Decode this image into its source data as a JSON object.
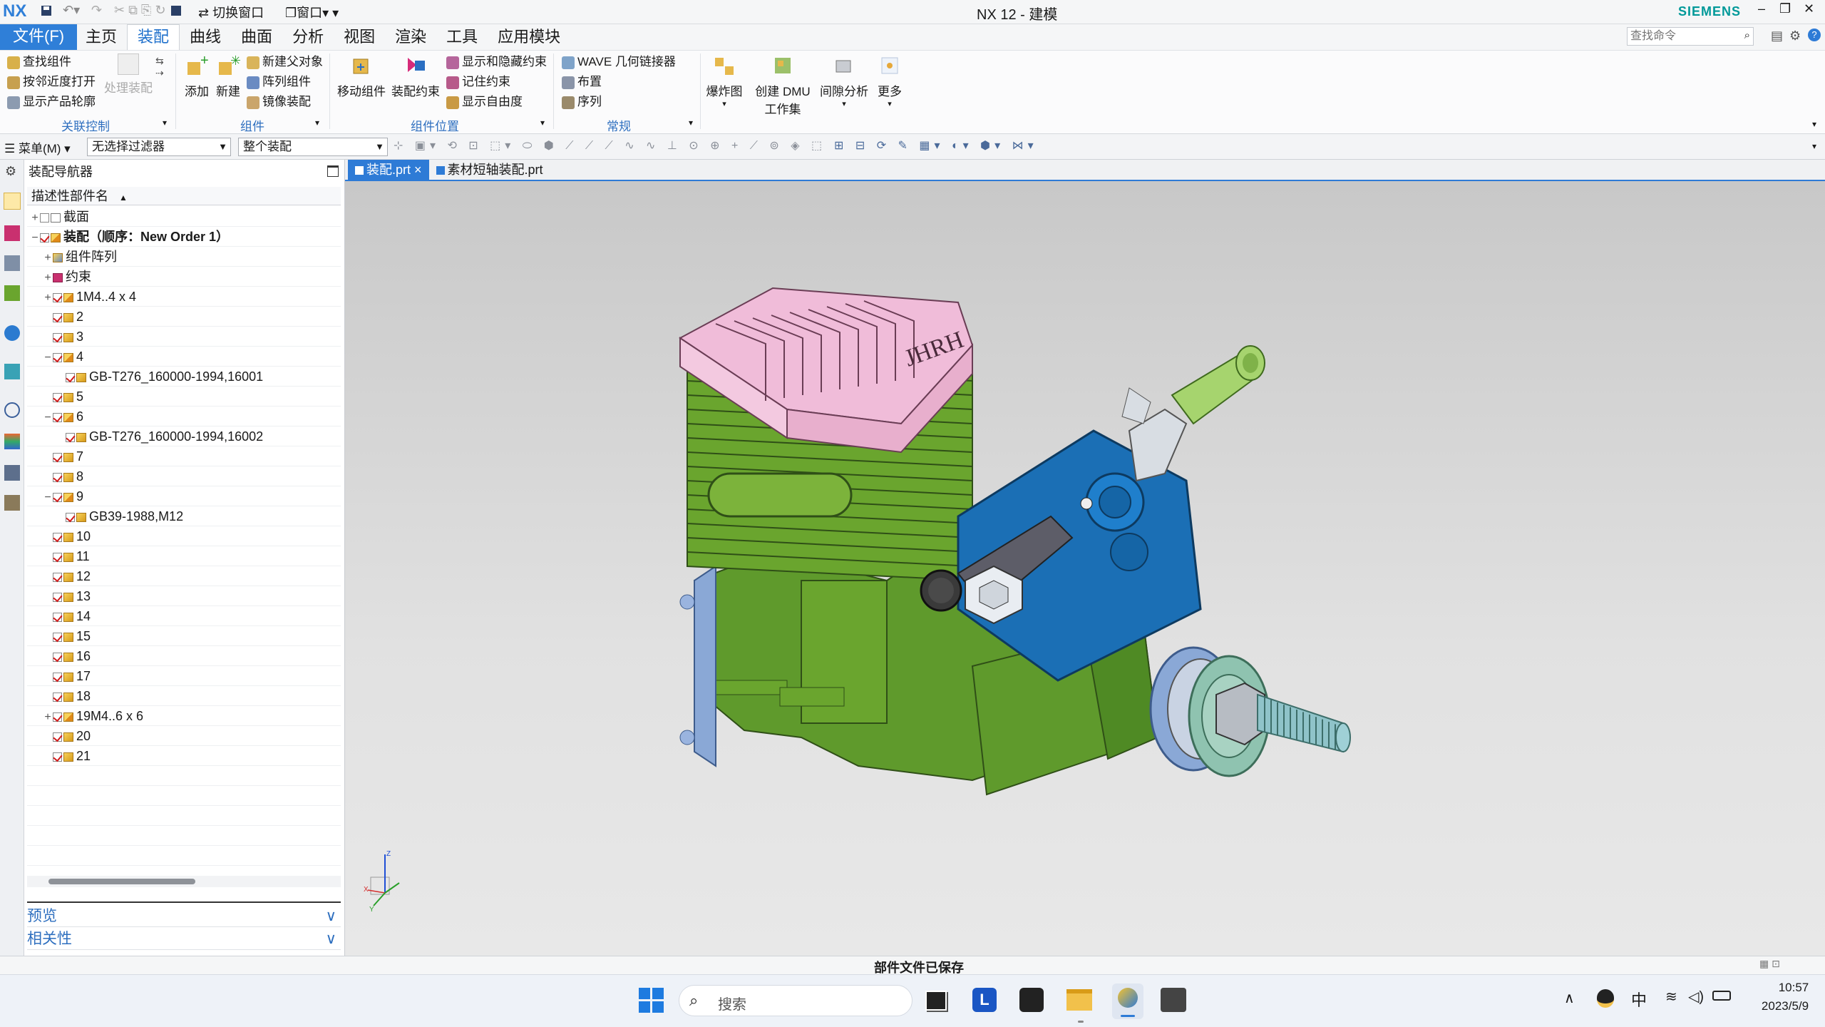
{
  "app": {
    "logo": "NX",
    "title": "NX 12 - 建模",
    "brand": "SIEMENS"
  },
  "quick": {
    "switch_window": "切换窗口",
    "window": "窗口"
  },
  "menu": {
    "file": "文件(F)",
    "items": [
      "主页",
      "装配",
      "曲线",
      "曲面",
      "分析",
      "视图",
      "渲染",
      "工具",
      "应用模块"
    ],
    "active": "装配"
  },
  "search": {
    "placeholder": "查找命令"
  },
  "ribbon": {
    "assoc": {
      "items": [
        "查找组件",
        "按邻近度打开",
        "显示产品轮廓"
      ],
      "process": "处理装配",
      "label": "关联控制"
    },
    "component": {
      "add": "添加",
      "new": "新建",
      "items": [
        "新建父对象",
        "阵列组件",
        "镜像装配"
      ],
      "label": "组件"
    },
    "position": {
      "move": "移动组件",
      "constraint": "装配约束",
      "items": [
        "显示和隐藏约束",
        "记住约束",
        "显示自由度"
      ],
      "label": "组件位置"
    },
    "general": {
      "items": [
        "WAVE 几何链接器",
        "布置",
        "序列"
      ],
      "label": "常规"
    },
    "explode": "爆炸图",
    "dmu1": "创建 DMU",
    "dmu2": "工作集",
    "clearance": "间隙分析",
    "more": "更多"
  },
  "selbar": {
    "menu": "菜单(M)",
    "filter": "无选择过滤器",
    "scope": "整个装配"
  },
  "nav": {
    "title": "装配导航器",
    "column": "描述性部件名",
    "rows": [
      {
        "t": "截面",
        "l": 0,
        "e": "+",
        "c": false,
        "k": "sec"
      },
      {
        "t": "装配（顺序：New Order 1）",
        "l": 0,
        "e": "−",
        "c": true,
        "k": "asm",
        "b": true
      },
      {
        "t": "组件阵列",
        "l": 1,
        "e": "+",
        "c": null,
        "k": "arr"
      },
      {
        "t": "约束",
        "l": 1,
        "e": "+",
        "c": null,
        "k": "con"
      },
      {
        "t": "1M4..4 x 4",
        "l": 1,
        "e": "+",
        "c": true,
        "k": "asm"
      },
      {
        "t": "2",
        "l": 1,
        "e": "",
        "c": true,
        "k": "part"
      },
      {
        "t": "3",
        "l": 1,
        "e": "",
        "c": true,
        "k": "part"
      },
      {
        "t": "4",
        "l": 1,
        "e": "−",
        "c": true,
        "k": "asm"
      },
      {
        "t": "GB-T276_160000-1994,16001",
        "l": 2,
        "e": "",
        "c": true,
        "k": "part"
      },
      {
        "t": "5",
        "l": 1,
        "e": "",
        "c": true,
        "k": "part"
      },
      {
        "t": "6",
        "l": 1,
        "e": "−",
        "c": true,
        "k": "asm"
      },
      {
        "t": "GB-T276_160000-1994,16002",
        "l": 2,
        "e": "",
        "c": true,
        "k": "part"
      },
      {
        "t": "7",
        "l": 1,
        "e": "",
        "c": true,
        "k": "part"
      },
      {
        "t": "8",
        "l": 1,
        "e": "",
        "c": true,
        "k": "part"
      },
      {
        "t": "9",
        "l": 1,
        "e": "−",
        "c": true,
        "k": "asm"
      },
      {
        "t": "GB39-1988,M12",
        "l": 2,
        "e": "",
        "c": true,
        "k": "part"
      },
      {
        "t": "10",
        "l": 1,
        "e": "",
        "c": true,
        "k": "part"
      },
      {
        "t": "11",
        "l": 1,
        "e": "",
        "c": true,
        "k": "part"
      },
      {
        "t": "12",
        "l": 1,
        "e": "",
        "c": true,
        "k": "part"
      },
      {
        "t": "13",
        "l": 1,
        "e": "",
        "c": true,
        "k": "part"
      },
      {
        "t": "14",
        "l": 1,
        "e": "",
        "c": true,
        "k": "part"
      },
      {
        "t": "15",
        "l": 1,
        "e": "",
        "c": true,
        "k": "part"
      },
      {
        "t": "16",
        "l": 1,
        "e": "",
        "c": true,
        "k": "part"
      },
      {
        "t": "17",
        "l": 1,
        "e": "",
        "c": true,
        "k": "part"
      },
      {
        "t": "18",
        "l": 1,
        "e": "",
        "c": true,
        "k": "part"
      },
      {
        "t": "19M4..6 x 6",
        "l": 1,
        "e": "+",
        "c": true,
        "k": "asm"
      },
      {
        "t": "20",
        "l": 1,
        "e": "",
        "c": true,
        "k": "part"
      },
      {
        "t": "21",
        "l": 1,
        "e": "",
        "c": true,
        "k": "part"
      }
    ],
    "preview": "预览",
    "dependency": "相关性"
  },
  "tabs": [
    {
      "label": "装配.prt",
      "active": true
    },
    {
      "label": "素材短轴装配.prt",
      "active": false
    }
  ],
  "model": {
    "engraving": "JHRH"
  },
  "status": "部件文件已保存",
  "taskbar": {
    "search": "搜索",
    "ime": "中",
    "time": "10:57",
    "date": "2023/5/9"
  },
  "colors": {
    "accent": "#2e7bd6",
    "cylinder": "#6aa52e",
    "head": "#f0bcd9",
    "carb": "#1b6fb5",
    "brand": "#009999"
  }
}
